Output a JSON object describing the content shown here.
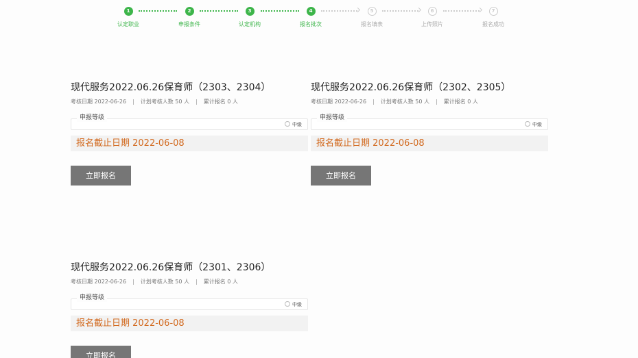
{
  "stepper": {
    "steps": [
      {
        "num": "1",
        "label": "认定职业",
        "state": "done"
      },
      {
        "num": "2",
        "label": "申报条件",
        "state": "done"
      },
      {
        "num": "3",
        "label": "认定机构",
        "state": "done"
      },
      {
        "num": "4",
        "label": "报名批次",
        "state": "done"
      },
      {
        "num": "5",
        "label": "报名填表",
        "state": "todo"
      },
      {
        "num": "6",
        "label": "上传照片",
        "state": "todo"
      },
      {
        "num": "7",
        "label": "报名成功",
        "state": "todo"
      }
    ]
  },
  "cards": [
    {
      "title": "现代服务2022.06.26保育师（2303、2304）",
      "exam_date": "考核日期 2022-06-26",
      "planned": "计划考核人数 50 人",
      "registered": "累计报名 0 人",
      "level_legend": "申报等级",
      "level_option": "中级",
      "deadline": "报名截止日期 2022-06-08",
      "button": "立即报名"
    },
    {
      "title": "现代服务2022.06.26保育师（2302、2305）",
      "exam_date": "考核日期 2022-06-26",
      "planned": "计划考核人数 50 人",
      "registered": "累计报名 0 人",
      "level_legend": "申报等级",
      "level_option": "中级",
      "deadline": "报名截止日期 2022-06-08",
      "button": "立即报名"
    },
    {
      "title": "现代服务2022.06.26保育师（2301、2306）",
      "exam_date": "考核日期 2022-06-26",
      "planned": "计划考核人数 50 人",
      "registered": "累计报名 0 人",
      "level_legend": "申报等级",
      "level_option": "中级",
      "deadline": "报名截止日期 2022-06-08",
      "button": "立即报名"
    }
  ],
  "colors": {
    "done": "#3db54a",
    "todo": "#cccccc",
    "deadline": "#d2691e",
    "button": "#767676"
  }
}
